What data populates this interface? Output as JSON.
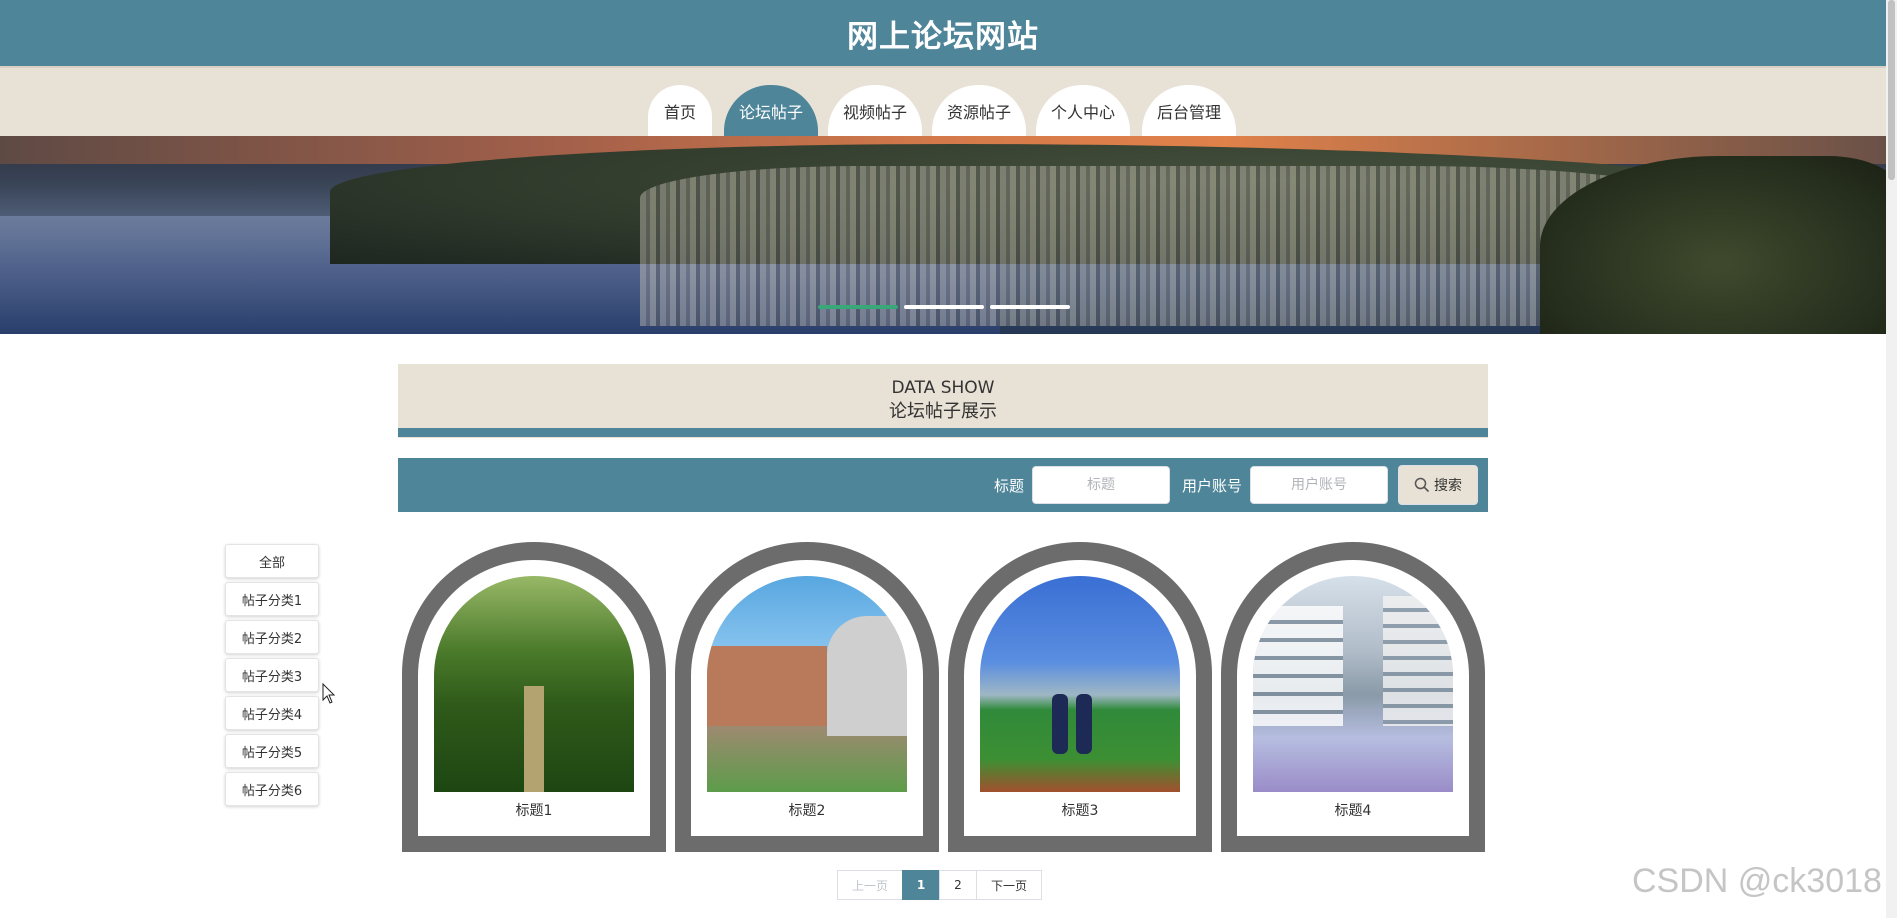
{
  "header": {
    "title": "网上论坛网站"
  },
  "nav": {
    "items": [
      {
        "label": "首页"
      },
      {
        "label": "论坛帖子",
        "active": true
      },
      {
        "label": "视频帖子"
      },
      {
        "label": "资源帖子"
      },
      {
        "label": "个人中心"
      },
      {
        "label": "后台管理"
      }
    ]
  },
  "banner": {
    "slide_count": 3,
    "active_slide": 1
  },
  "section": {
    "title_en": "DATA SHOW",
    "title_cn": "论坛帖子展示"
  },
  "search": {
    "title_label": "标题",
    "title_placeholder": "标题",
    "account_label": "用户账号",
    "account_placeholder": "用户账号",
    "button_label": "搜索"
  },
  "categories": [
    "全部",
    "帖子分类1",
    "帖子分类2",
    "帖子分类3",
    "帖子分类4",
    "帖子分类5",
    "帖子分类6"
  ],
  "cards": [
    {
      "title": "标题1"
    },
    {
      "title": "标题2"
    },
    {
      "title": "标题3"
    },
    {
      "title": "标题4"
    }
  ],
  "pagination": {
    "prev": "上一页",
    "pages": [
      "1",
      "2"
    ],
    "current": "1",
    "next": "下一页"
  },
  "watermark": "CSDN @ck3018",
  "colors": {
    "primary": "#4e8599",
    "beige": "#e8e1d6",
    "card_frame": "#6c6c6c",
    "indicator_active": "#3aa779"
  }
}
